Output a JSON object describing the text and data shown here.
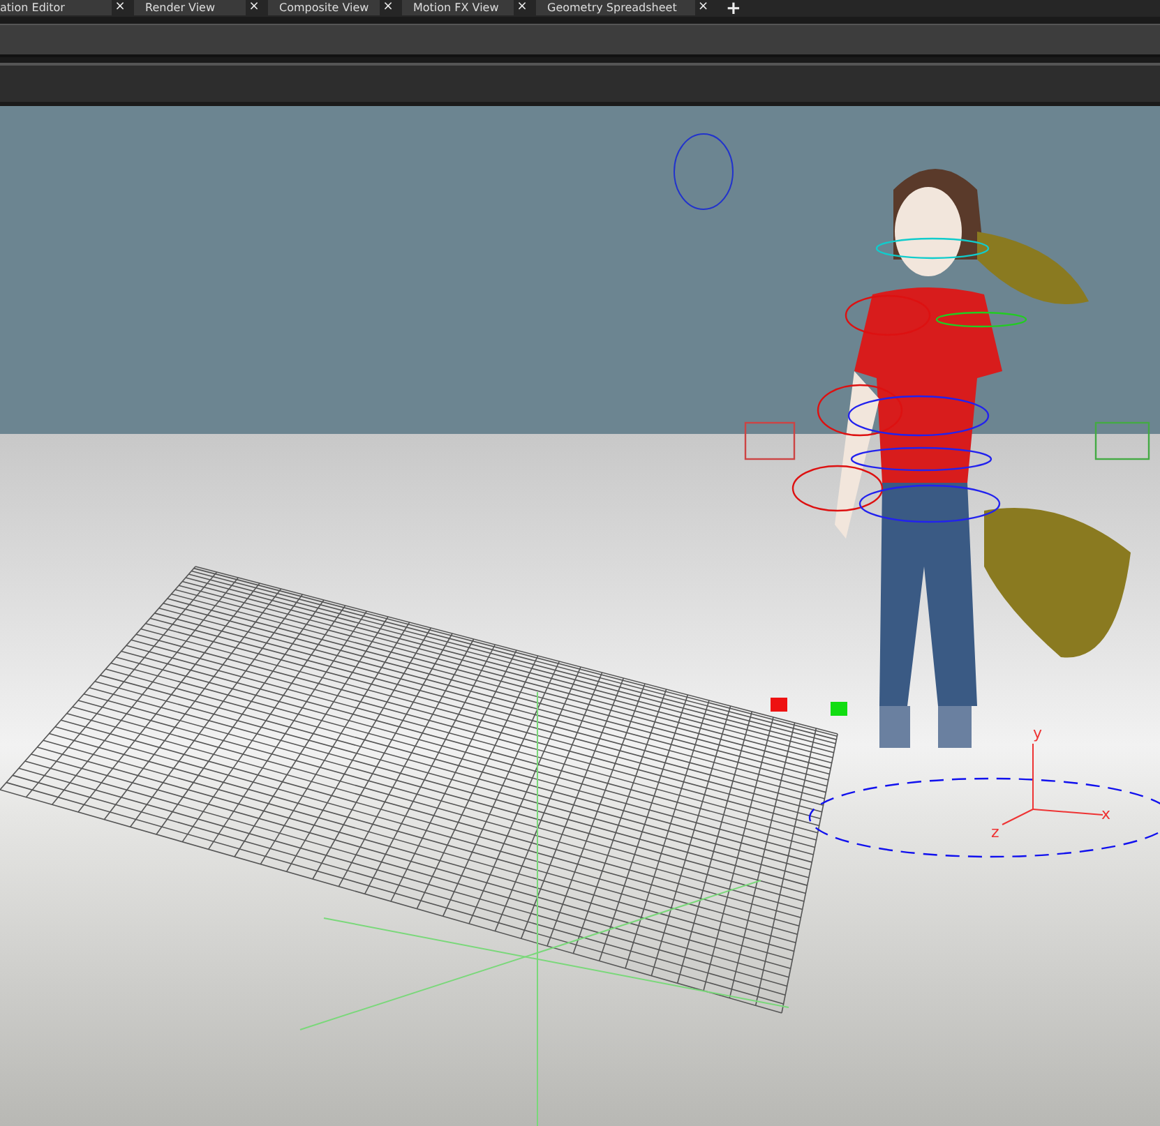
{
  "tabs": [
    {
      "label": "ation Editor",
      "close": "×",
      "selected": false
    },
    {
      "label": "Render View",
      "close": "×",
      "selected": false
    },
    {
      "label": "Composite View",
      "close": "×",
      "selected": false
    },
    {
      "label": "Motion FX View",
      "close": "×",
      "selected": false
    },
    {
      "label": "Geometry Spreadsheet",
      "close": "×",
      "selected": false
    }
  ],
  "add_tab": "+",
  "viewport": {
    "axis_labels": {
      "y": "y",
      "x": "x",
      "z": "z"
    }
  }
}
